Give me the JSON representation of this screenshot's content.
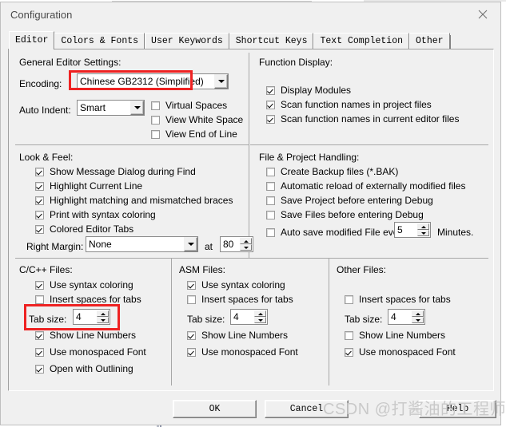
{
  "window": {
    "title": "Configuration",
    "close_icon": "close-icon"
  },
  "tabs": [
    {
      "label": "Editor",
      "active": true
    },
    {
      "label": "Colors & Fonts",
      "active": false
    },
    {
      "label": "User Keywords",
      "active": false
    },
    {
      "label": "Shortcut Keys",
      "active": false
    },
    {
      "label": "Text Completion",
      "active": false
    },
    {
      "label": "Other",
      "active": false
    }
  ],
  "general_editor_settings": {
    "title": "General Editor Settings:",
    "encoding_label": "Encoding:",
    "encoding_value": "Chinese GB2312 (Simplified)",
    "auto_indent_label": "Auto Indent:",
    "auto_indent_value": "Smart",
    "checkboxes": [
      {
        "label": "Virtual Spaces",
        "checked": false
      },
      {
        "label": "View White Space",
        "checked": false
      },
      {
        "label": "View End of Line",
        "checked": false
      }
    ]
  },
  "function_display": {
    "title": "Function Display:",
    "checkboxes": [
      {
        "label": "Display Modules",
        "checked": true
      },
      {
        "label": "Scan function names in project files",
        "checked": true
      },
      {
        "label": "Scan function names in current editor files",
        "checked": true
      }
    ]
  },
  "look_and_feel": {
    "title": "Look & Feel:",
    "checkboxes": [
      {
        "label": "Show Message Dialog during Find",
        "checked": true
      },
      {
        "label": "Highlight Current Line",
        "checked": true
      },
      {
        "label": "Highlight matching and mismatched braces",
        "checked": true
      },
      {
        "label": "Print with syntax coloring",
        "checked": true
      },
      {
        "label": "Colored Editor Tabs",
        "checked": true
      }
    ],
    "right_margin_label": "Right Margin:",
    "right_margin_value": "None",
    "at_label": "at",
    "at_value": "80"
  },
  "file_project_handling": {
    "title": "File & Project Handling:",
    "checkboxes": [
      {
        "label": "Create Backup files (*.BAK)",
        "checked": false
      },
      {
        "label": "Automatic reload of externally modified files",
        "checked": false
      },
      {
        "label": "Save Project before entering Debug",
        "checked": false
      },
      {
        "label": "Save Files before entering Debug",
        "checked": false
      },
      {
        "label": "Auto save modified File every",
        "checked": false
      }
    ],
    "autosave_value": "5",
    "minutes_label": "Minutes."
  },
  "c_cpp_files": {
    "title": "C/C++ Files:",
    "use_syntax_coloring": {
      "label": "Use syntax coloring",
      "checked": true
    },
    "insert_spaces": {
      "label": "Insert spaces for tabs",
      "checked": false
    },
    "tab_size_label": "Tab size:",
    "tab_size_value": "4",
    "show_line_numbers": {
      "label": "Show Line Numbers",
      "checked": true
    },
    "use_monospaced_font": {
      "label": "Use monospaced Font",
      "checked": true
    },
    "open_with_outlining": {
      "label": "Open with Outlining",
      "checked": true
    }
  },
  "asm_files": {
    "title": "ASM Files:",
    "use_syntax_coloring": {
      "label": "Use syntax coloring",
      "checked": true
    },
    "insert_spaces": {
      "label": "Insert spaces for tabs",
      "checked": false
    },
    "tab_size_label": "Tab size:",
    "tab_size_value": "4",
    "show_line_numbers": {
      "label": "Show Line Numbers",
      "checked": true
    },
    "use_monospaced_font": {
      "label": "Use monospaced Font",
      "checked": true
    }
  },
  "other_files": {
    "title": "Other Files:",
    "insert_spaces": {
      "label": "Insert spaces for tabs",
      "checked": false
    },
    "tab_size_label": "Tab size:",
    "tab_size_value": "4",
    "show_line_numbers": {
      "label": "Show Line Numbers",
      "checked": false
    },
    "use_monospaced_font": {
      "label": "Use monospaced Font",
      "checked": true
    }
  },
  "buttons": {
    "ok": "OK",
    "cancel": "Cancel",
    "help": "Help"
  },
  "watermark": "CSDN @打酱油的工程师",
  "colors": {
    "annotation": "#ee2222",
    "dialog_bg": "#f0f0f0",
    "field_bg": "#ffffff"
  }
}
